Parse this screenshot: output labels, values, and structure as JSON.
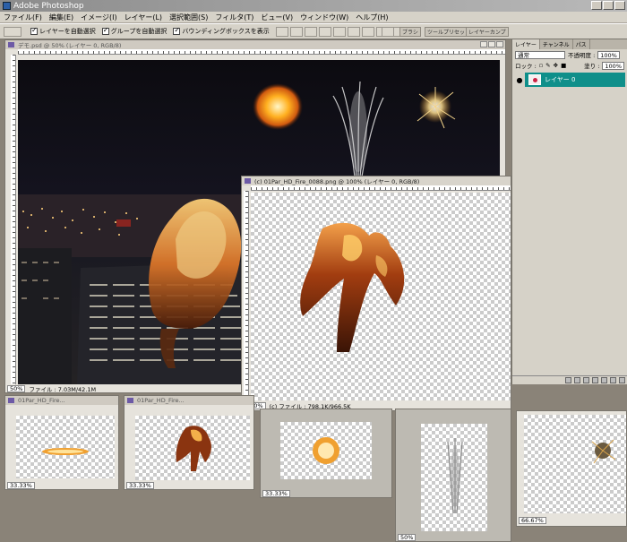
{
  "app": {
    "title": "Adobe Photoshop"
  },
  "menu": [
    "ファイル(F)",
    "編集(E)",
    "イメージ(I)",
    "レイヤー(L)",
    "選択範囲(S)",
    "フィルタ(T)",
    "ビュー(V)",
    "ウィンドウ(W)",
    "ヘルプ(H)"
  ],
  "options": {
    "auto_select_layer": "レイヤーを自動選択",
    "auto_select_group": "グループを自動選択",
    "show_bounding_box": "バウンディングボックスを表示",
    "tab_brushes": "ブラシ",
    "tab_tool_presets": "ツールプリセット",
    "tab_layer_comps": "レイヤーカンプ"
  },
  "doc_main": {
    "title": "デモ.psd @ 50% (レイヤー 0, RGB/8)",
    "zoom": "50%",
    "file_info": "ファイル : 7.03M/42.1M"
  },
  "doc_fire": {
    "title": "(c) 01Par_HD_Fire_0088.png @ 100% (レイヤー 0, RGB/8)",
    "zoom": "100%",
    "file_info": "(c) ファイル : 798.1K/966.5K"
  },
  "thumbs": [
    {
      "title": "01Par_HD_Fire...",
      "zoom": "33.33%"
    },
    {
      "title": "01Par_HD_Fire...",
      "zoom": "33.33%"
    },
    {
      "title": "01Par_HD_Fire...",
      "zoom": "33.33%"
    },
    {
      "title": "01Par_HD_Fire...",
      "zoom": "50%"
    },
    {
      "title": "01Par_HD_Fire...",
      "zoom": "66.67%"
    }
  ],
  "layers_panel": {
    "tab_layers": "レイヤー",
    "tab_channels": "チャンネル",
    "tab_paths": "パス",
    "blend_mode": "通常",
    "opacity_label": "不透明度 :",
    "opacity_value": "100%",
    "lock_label": "ロック :",
    "fill_label": "塗り :",
    "fill_value": "100%",
    "layer_name": "レイヤー 0"
  },
  "colors": {
    "accent_layer": "#0f8f8a",
    "chrome": "#d6d2c8",
    "desktop": "#8a8378"
  }
}
